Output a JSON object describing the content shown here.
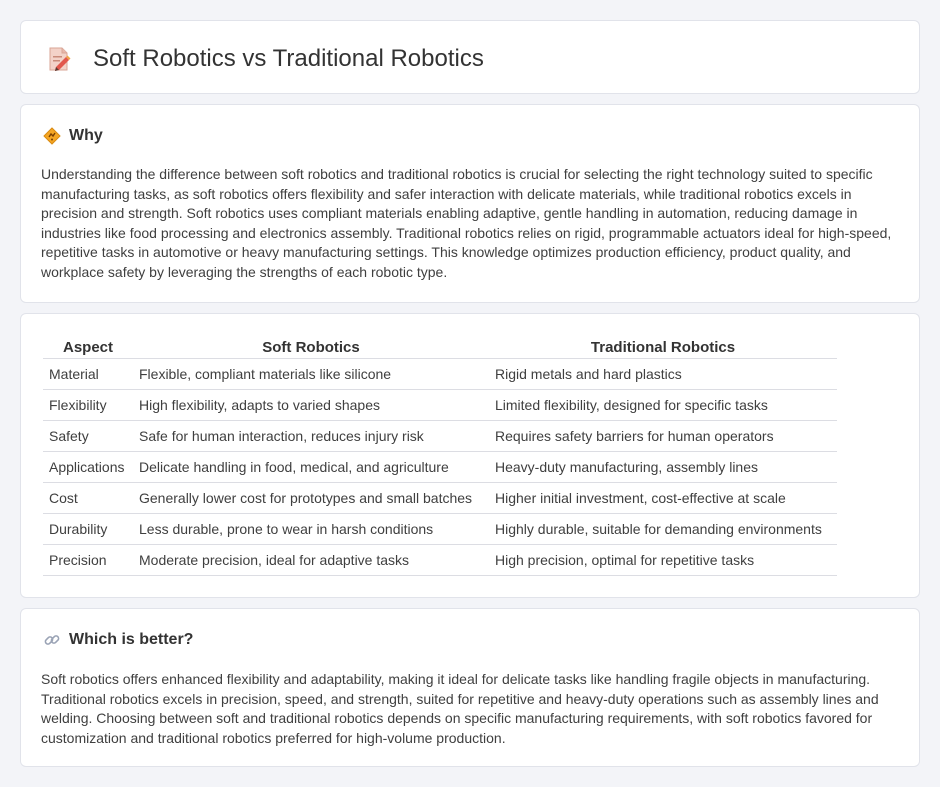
{
  "header": {
    "title": "Soft Robotics vs Traditional Robotics",
    "icon": "document-pencil-icon"
  },
  "why": {
    "title": "Why",
    "icon": "diamond-sign-icon",
    "body": "Understanding the difference between soft robotics and traditional robotics is crucial for selecting the right technology suited to specific manufacturing tasks, as soft robotics offers flexibility and safer interaction with delicate materials, while traditional robotics excels in precision and strength. Soft robotics uses compliant materials enabling adaptive, gentle handling in automation, reducing damage in industries like food processing and electronics assembly. Traditional robotics relies on rigid, programmable actuators ideal for high-speed, repetitive tasks in automotive or heavy manufacturing settings. This knowledge optimizes production efficiency, product quality, and workplace safety by leveraging the strengths of each robotic type."
  },
  "table": {
    "headers": [
      "Aspect",
      "Soft Robotics",
      "Traditional Robotics"
    ],
    "rows": [
      [
        "Material",
        "Flexible, compliant materials like silicone",
        "Rigid metals and hard plastics"
      ],
      [
        "Flexibility",
        "High flexibility, adapts to varied shapes",
        "Limited flexibility, designed for specific tasks"
      ],
      [
        "Safety",
        "Safe for human interaction, reduces injury risk",
        "Requires safety barriers for human operators"
      ],
      [
        "Applications",
        "Delicate handling in food, medical, and agriculture",
        "Heavy-duty manufacturing, assembly lines"
      ],
      [
        "Cost",
        "Generally lower cost for prototypes and small batches",
        "Higher initial investment, cost-effective at scale"
      ],
      [
        "Durability",
        "Less durable, prone to wear in harsh conditions",
        "Highly durable, suitable for demanding environments"
      ],
      [
        "Precision",
        "Moderate precision, ideal for adaptive tasks",
        "High precision, optimal for repetitive tasks"
      ]
    ]
  },
  "better": {
    "title": "Which is better?",
    "icon": "link-icon",
    "body": "Soft robotics offers enhanced flexibility and adaptability, making it ideal for delicate tasks like handling fragile objects in manufacturing. Traditional robotics excels in precision, speed, and strength, suited for repetitive and heavy-duty operations such as assembly lines and welding. Choosing between soft and traditional robotics depends on specific manufacturing requirements, with soft robotics favored for customization and traditional robotics preferred for high-volume production."
  },
  "colors": {
    "page_bg": "#f3f4f8",
    "card_bg": "#ffffff",
    "text": "#3f3f3f"
  }
}
